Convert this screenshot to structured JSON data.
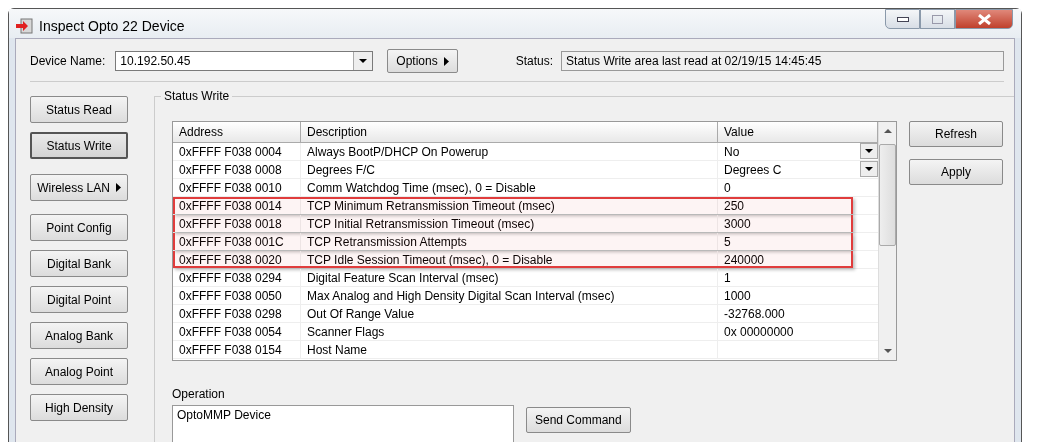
{
  "window": {
    "title": "Inspect Opto 22 Device"
  },
  "device_name": {
    "label": "Device Name:",
    "value": "10.192.50.45"
  },
  "options_button": {
    "label": "Options"
  },
  "status": {
    "label": "Status:",
    "value": "Status Write area last read at 02/19/15 14:45:45"
  },
  "nav_buttons": [
    {
      "label": "Status Read",
      "kind": "plain",
      "selected": false
    },
    {
      "label": "Status Write",
      "kind": "plain",
      "selected": true
    },
    {
      "label": "Wireless LAN",
      "kind": "submenu",
      "selected": false
    },
    {
      "label": "Point Config",
      "kind": "plain",
      "selected": false
    },
    {
      "label": "Digital Bank",
      "kind": "plain",
      "selected": false
    },
    {
      "label": "Digital Point",
      "kind": "plain",
      "selected": false
    },
    {
      "label": "Analog Bank",
      "kind": "plain",
      "selected": false
    },
    {
      "label": "Analog Point",
      "kind": "plain",
      "selected": false
    },
    {
      "label": "High Density",
      "kind": "plain",
      "selected": false
    }
  ],
  "group": {
    "title": "Status Write"
  },
  "table": {
    "columns": [
      "Address",
      "Description",
      "Value"
    ],
    "rows": [
      {
        "address": "0xFFFF F038 0004",
        "description": "Always BootP/DHCP On Powerup",
        "value": "No",
        "kind": "dropdown",
        "highlighted": false
      },
      {
        "address": "0xFFFF F038 0008",
        "description": "Degrees F/C",
        "value": "Degrees C",
        "kind": "dropdown",
        "highlighted": false
      },
      {
        "address": "0xFFFF F038 0010",
        "description": "Comm Watchdog Time (msec), 0 = Disable",
        "value": "0",
        "kind": "text",
        "highlighted": false
      },
      {
        "address": "0xFFFF F038 0014",
        "description": "TCP Minimum Retransmission Timeout (msec)",
        "value": "250",
        "kind": "text",
        "highlighted": true
      },
      {
        "address": "0xFFFF F038 0018",
        "description": "TCP Initial Retransmission Timeout (msec)",
        "value": "3000",
        "kind": "text",
        "highlighted": true
      },
      {
        "address": "0xFFFF F038 001C",
        "description": "TCP Retransmission Attempts",
        "value": "5",
        "kind": "text",
        "highlighted": true
      },
      {
        "address": "0xFFFF F038 0020",
        "description": "TCP Idle Session Timeout (msec), 0 = Disable",
        "value": "240000",
        "kind": "text",
        "highlighted": true
      },
      {
        "address": "0xFFFF F038 0294",
        "description": "Digital Feature Scan Interval (msec)",
        "value": "1",
        "kind": "text",
        "highlighted": false
      },
      {
        "address": "0xFFFF F038 0050",
        "description": "Max Analog and High Density Digital Scan Interval (msec)",
        "value": "1000",
        "kind": "text",
        "highlighted": false
      },
      {
        "address": "0xFFFF F038 0298",
        "description": "Out Of Range Value",
        "value": "-32768.000",
        "kind": "text",
        "highlighted": false
      },
      {
        "address": "0xFFFF F038 0054",
        "description": "Scanner Flags",
        "value": "0x 00000000",
        "kind": "text",
        "highlighted": false
      },
      {
        "address": "0xFFFF F038 0154",
        "description": "Host Name",
        "value": "",
        "kind": "text",
        "highlighted": false
      }
    ]
  },
  "side_buttons": [
    "Refresh",
    "Apply"
  ],
  "operation": {
    "label": "Operation",
    "items": [
      "OptoMMP Device"
    ]
  },
  "send_button": {
    "label": "Send Command"
  }
}
